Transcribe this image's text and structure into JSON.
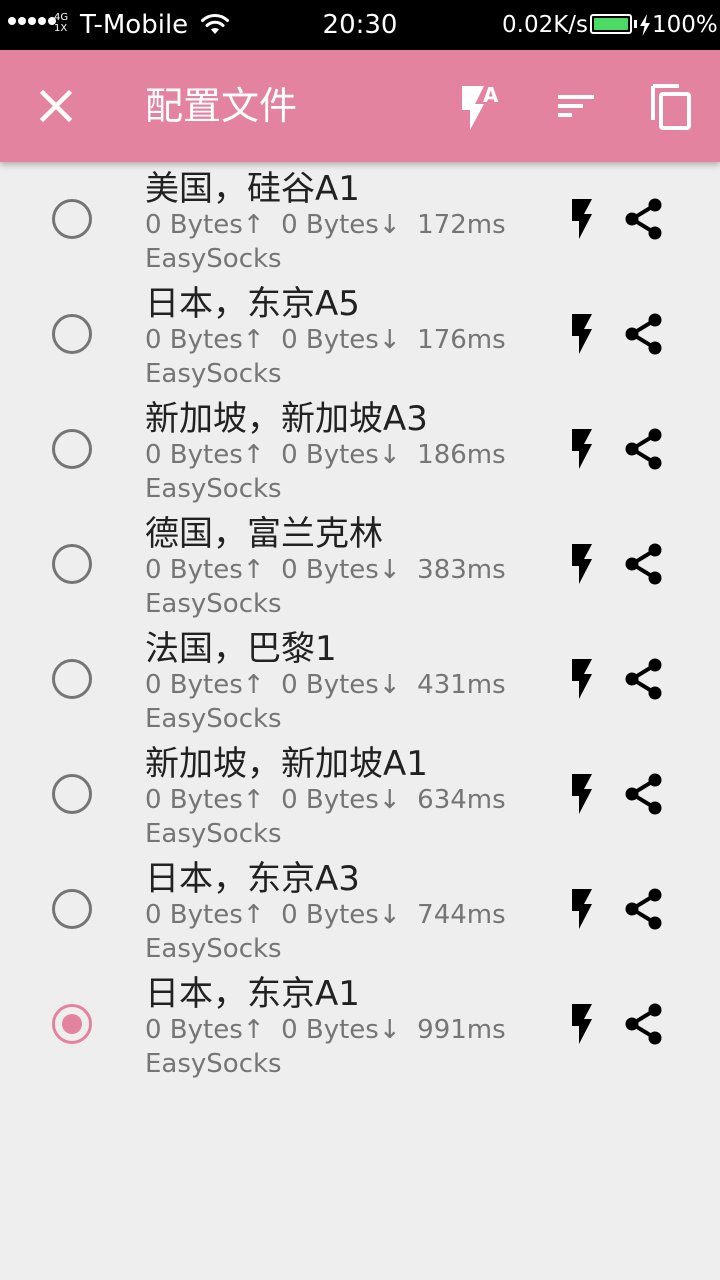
{
  "status_bar": {
    "network": "4G\n1X",
    "carrier": "T-Mobile",
    "time": "20:30",
    "speed": "0.02K/s",
    "battery": "100%",
    "battery_level": 1.0,
    "battery_color": "#4cd964"
  },
  "toolbar": {
    "title": "配置文件",
    "close_icon": "close-icon",
    "test_icon": "flash-auto-icon",
    "sort_icon": "sort-icon",
    "copy_icon": "copy-icon",
    "color": "#e4839f"
  },
  "profiles": [
    {
      "name": "美国，硅谷A1",
      "stats": "0 Bytes↑  0 Bytes↓  172ms",
      "type": "EasySocks",
      "selected": false
    },
    {
      "name": "日本，东京A5",
      "stats": "0 Bytes↑  0 Bytes↓  176ms",
      "type": "EasySocks",
      "selected": false
    },
    {
      "name": "新加坡，新加坡A3",
      "stats": "0 Bytes↑  0 Bytes↓  186ms",
      "type": "EasySocks",
      "selected": false
    },
    {
      "name": "德国，富兰克林",
      "stats": "0 Bytes↑  0 Bytes↓  383ms",
      "type": "EasySocks",
      "selected": false
    },
    {
      "name": "法国，巴黎1",
      "stats": "0 Bytes↑  0 Bytes↓  431ms",
      "type": "EasySocks",
      "selected": false
    },
    {
      "name": "新加坡，新加坡A1",
      "stats": "0 Bytes↑  0 Bytes↓  634ms",
      "type": "EasySocks",
      "selected": false
    },
    {
      "name": "日本，东京A3",
      "stats": "0 Bytes↑  0 Bytes↓  744ms",
      "type": "EasySocks",
      "selected": false
    },
    {
      "name": "日本，东京A1",
      "stats": "0 Bytes↑  0 Bytes↓  991ms",
      "type": "EasySocks",
      "selected": true
    }
  ]
}
